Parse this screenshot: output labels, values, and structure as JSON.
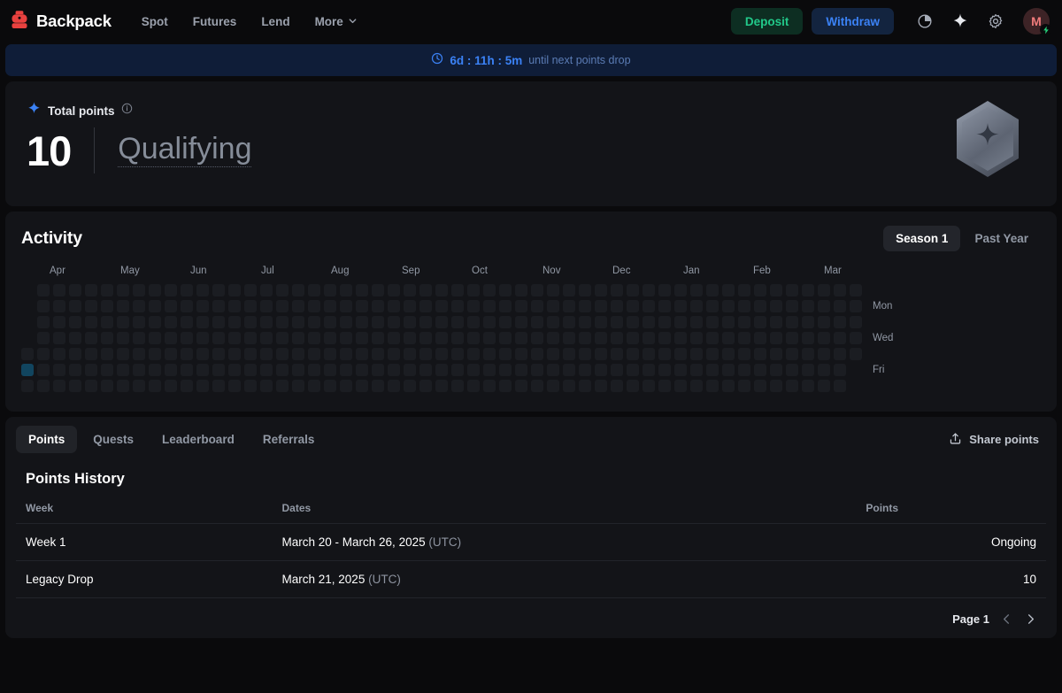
{
  "header": {
    "brand": "Backpack",
    "nav": [
      {
        "label": "Spot",
        "icon": null
      },
      {
        "label": "Futures",
        "icon": null
      },
      {
        "label": "Lend",
        "icon": null
      },
      {
        "label": "More",
        "icon": "chevron-down-icon"
      }
    ],
    "deposit_label": "Deposit",
    "withdraw_label": "Withdraw",
    "icons": [
      "pie-chart-icon",
      "sparkle-icon",
      "gear-icon"
    ],
    "avatar_initial": "M",
    "avatar_badge_icon": "lightning-bolt-icon",
    "colors": {
      "deposit_text": "#22c98a",
      "deposit_bg": "#0d2e22",
      "withdraw_text": "#3b82f6",
      "withdraw_bg": "#13243f",
      "brand_red": "#e8413f"
    }
  },
  "banner": {
    "icon": "clock-icon",
    "countdown": "6d : 11h : 5m",
    "suffix": "until next points drop",
    "bg": "#0f1d38",
    "accent": "#3b82f6"
  },
  "points_card": {
    "icon": "sparkle-icon",
    "label": "Total points",
    "info_icon": "info-icon",
    "value": "10",
    "status": "Qualifying",
    "badge_icon": "hexagon-star-badge"
  },
  "activity": {
    "title": "Activity",
    "toggle": [
      {
        "label": "Season 1",
        "active": true
      },
      {
        "label": "Past Year",
        "active": false
      }
    ],
    "months": [
      "Apr",
      "May",
      "Jun",
      "Jul",
      "Aug",
      "Sep",
      "Oct",
      "Nov",
      "Dec",
      "Jan",
      "Feb",
      "Mar"
    ],
    "day_labels": [
      "Mon",
      "Wed",
      "Fri"
    ],
    "legend_colors": {
      "empty": "#1b1d22",
      "level1": "#11455f"
    },
    "total_weeks": 53,
    "first_week_start_row": 4,
    "last_week_end_row": 4,
    "active_cells": [
      {
        "week": 0,
        "day": 5
      }
    ]
  },
  "tabs": {
    "items": [
      {
        "label": "Points",
        "active": true
      },
      {
        "label": "Quests",
        "active": false
      },
      {
        "label": "Leaderboard",
        "active": false
      },
      {
        "label": "Referrals",
        "active": false
      }
    ],
    "share_label": "Share points",
    "share_icon": "share-upload-icon"
  },
  "history": {
    "title": "Points History",
    "columns": [
      "Week",
      "Dates",
      "Points"
    ],
    "rows": [
      {
        "week": "Week 1",
        "dates": "March 20 - March 26, 2025",
        "tz": "(UTC)",
        "points": "Ongoing",
        "points_muted": true
      },
      {
        "week": "Legacy Drop",
        "dates": "March 21, 2025",
        "tz": "(UTC)",
        "points": "10",
        "points_muted": false
      }
    ],
    "pager": {
      "label": "Page 1",
      "prev_icon": "chevron-left-icon",
      "next_icon": "chevron-right-icon"
    }
  }
}
